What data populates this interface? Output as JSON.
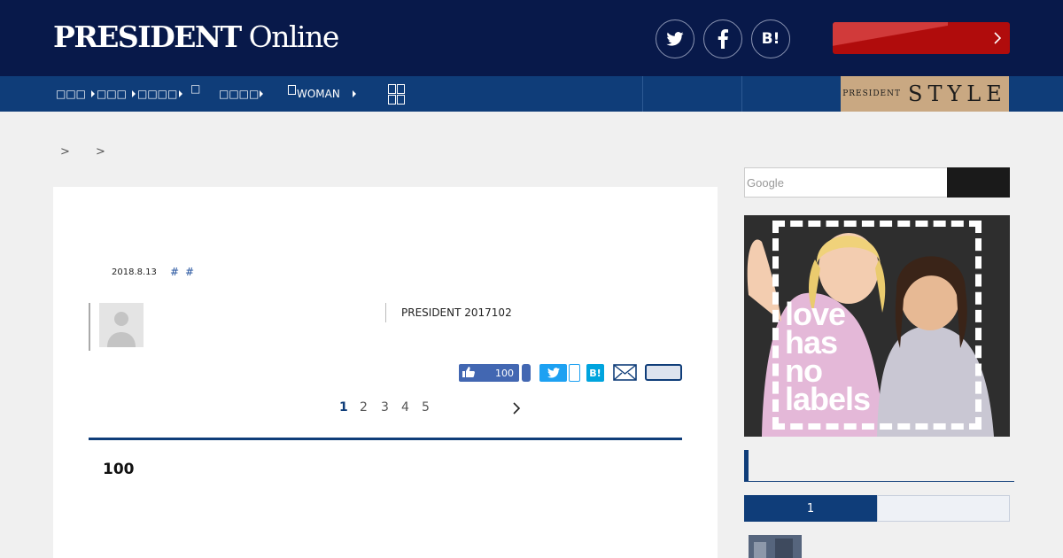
{
  "header": {
    "logo_main": "PRESIDENT",
    "logo_sub": "Online",
    "social": [
      {
        "name": "twitter",
        "icon": "twitter-icon"
      },
      {
        "name": "facebook",
        "icon": "facebook-icon"
      },
      {
        "name": "hatena",
        "icon": "hatena-bookmark-icon",
        "label": "B!"
      }
    ],
    "cta_color": "#b00c0c"
  },
  "nav": {
    "items": [
      {
        "label": "□□□"
      },
      {
        "label": "□□□"
      },
      {
        "label": "□□□□"
      },
      {
        "label": "□"
      },
      {
        "label": "□□□□"
      },
      {
        "label": "WOMAN"
      },
      {
        "label": ""
      }
    ],
    "style_banner": {
      "small": "PRESIDENT",
      "big": "STYLE"
    }
  },
  "breadcrumb": [
    ">",
    ">"
  ],
  "article": {
    "date": "2018.8.13",
    "tags": [
      "#",
      "#"
    ],
    "source": "PRESIDENT 2017102",
    "like_count": "100",
    "hatena_label": "B!",
    "pages": [
      "1",
      "2",
      "3",
      "4",
      "5"
    ],
    "current_page": "1",
    "section_heading": "100"
  },
  "sidebar": {
    "search_placeholder": "Google",
    "ad_text": [
      "love",
      "has",
      "no",
      "labels"
    ],
    "ranking_tab_active": "1"
  },
  "colors": {
    "navy": "#08194a",
    "nav_blue": "#0f3d79",
    "facebook": "#4267b2",
    "twitter": "#1da1f2",
    "hatena": "#00a4de",
    "style_gold": "#c9a882"
  }
}
